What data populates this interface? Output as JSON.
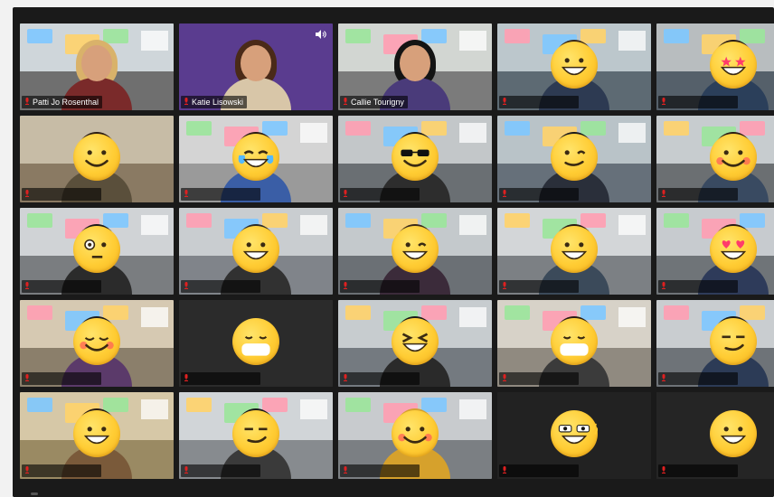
{
  "meeting": {
    "participants": [
      {
        "name": "Patti Jo Rosenthal",
        "emoji": "teacher-face",
        "scene": "classroom-posters",
        "active": true
      },
      {
        "name": "Katie Lisowski",
        "emoji": "teacher-face",
        "scene": "purple-space"
      },
      {
        "name": "Callie Tourigny",
        "emoji": "teacher-face",
        "scene": "classroom-posters"
      },
      {
        "name": "",
        "emoji": "grinning-face-icon",
        "scene": "classroom"
      },
      {
        "name": "",
        "emoji": "star-struck-icon",
        "scene": "classroom"
      },
      {
        "name": "",
        "emoji": "smiley-face-icon",
        "scene": "office"
      },
      {
        "name": "",
        "emoji": "tears-of-joy-icon",
        "scene": "classroom"
      },
      {
        "name": "",
        "emoji": "sunglasses-face-icon",
        "scene": "classroom"
      },
      {
        "name": "",
        "emoji": "winking-face-icon",
        "scene": "classroom"
      },
      {
        "name": "",
        "emoji": "smiling-blush-icon",
        "scene": "classroom"
      },
      {
        "name": "",
        "emoji": "face-with-monocle-icon",
        "scene": "classroom"
      },
      {
        "name": "",
        "emoji": "beaming-face-icon",
        "scene": "classroom"
      },
      {
        "name": "",
        "emoji": "wink-tongue-icon",
        "scene": "classroom"
      },
      {
        "name": "",
        "emoji": "grinning-big-eyes-icon",
        "scene": "classroom"
      },
      {
        "name": "",
        "emoji": "heart-eyes-icon",
        "scene": "classroom"
      },
      {
        "name": "",
        "emoji": "relieved-face-icon",
        "scene": "classroom"
      },
      {
        "name": "",
        "emoji": "mask-face-icon",
        "scene": "dark"
      },
      {
        "name": "",
        "emoji": "squinting-laugh-icon",
        "scene": "classroom"
      },
      {
        "name": "",
        "emoji": "mask-face-icon",
        "scene": "classroom"
      },
      {
        "name": "",
        "emoji": "smirk-face-icon",
        "scene": "classroom"
      },
      {
        "name": "",
        "emoji": "grin-face-icon",
        "scene": "classroom"
      },
      {
        "name": "",
        "emoji": "smirk-face-icon",
        "scene": "classroom"
      },
      {
        "name": "",
        "emoji": "blush-face-icon",
        "scene": "classroom"
      },
      {
        "name": "",
        "emoji": "cool-peace-icon",
        "scene": "dark"
      },
      {
        "name": "",
        "emoji": "grin-face-icon",
        "scene": "dark"
      }
    ]
  },
  "colors": {
    "window_bg": "#1a1a1a",
    "active_speaker_border": "#2fbf4f",
    "label_bg": "rgba(0,0,0,0.6)",
    "muted_red": "#e02020",
    "emoji_yellow": "#ffcc33"
  }
}
